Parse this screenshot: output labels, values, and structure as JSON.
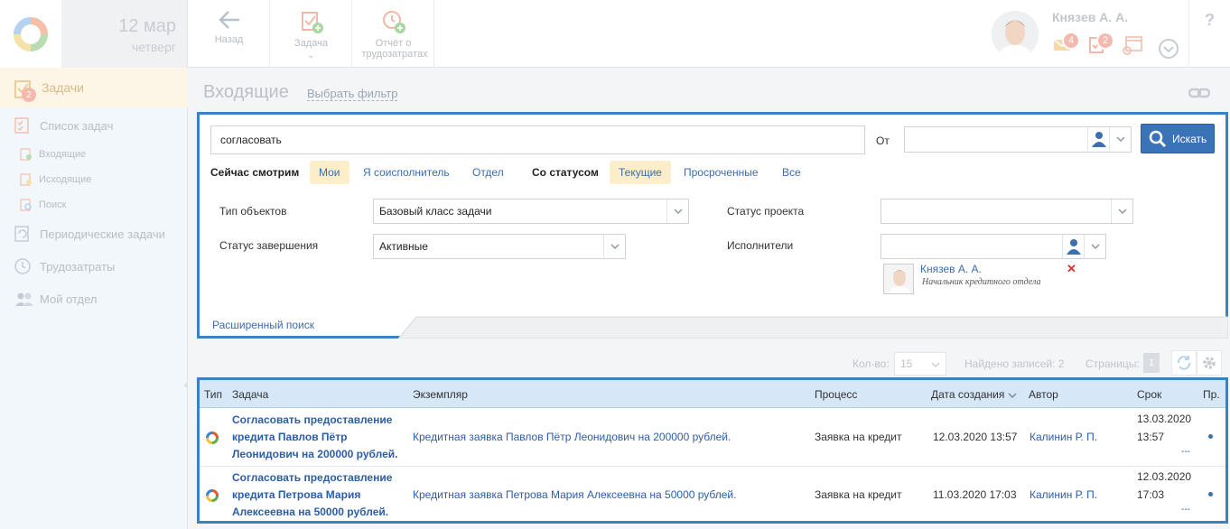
{
  "header": {
    "date_day": "12 мар",
    "date_weekday": "четверг",
    "toolbar": {
      "back": "Назад",
      "task": "Задача",
      "report": "Отчёт о трудозатратах"
    },
    "user": {
      "name": "Князев А. А.",
      "mail_count": "4",
      "tasks_count": "2"
    },
    "help": "?"
  },
  "sidebar": {
    "items": [
      {
        "label": "Задачи",
        "badge": "2"
      },
      {
        "label": "Список задач"
      },
      {
        "label": "Входящие"
      },
      {
        "label": "Исходящие"
      },
      {
        "label": "Поиск"
      },
      {
        "label": "Периодические задачи"
      },
      {
        "label": "Трудозатраты"
      },
      {
        "label": "Мой отдел"
      }
    ]
  },
  "page": {
    "title": "Входящие",
    "filter_link": "Выбрать фильтр"
  },
  "filter": {
    "query": "согласовать",
    "from_label": "От",
    "search_button": "Искать",
    "now_viewing_label": "Сейчас смотрим",
    "scope_chips": [
      "Мои",
      "Я соисполнитель",
      "Отдел"
    ],
    "status_label": "Со статусом",
    "status_chips": [
      "Текущие",
      "Просроченные",
      "Все"
    ],
    "object_type_label": "Тип объектов",
    "object_type_value": "Базовый класс задачи",
    "completion_status_label": "Статус завершения",
    "completion_status_value": "Активные",
    "project_status_label": "Статус проекта",
    "executors_label": "Исполнители",
    "executor": {
      "name": "Князев А. А.",
      "role": "Начальник кредитного отдела"
    },
    "advanced_search": "Расширенный поиск"
  },
  "pager": {
    "count_label": "Кол-во:",
    "count_value": "15",
    "found_label": "Найдено записей: 2",
    "pages_label": "Страницы:",
    "page_value": "1"
  },
  "table": {
    "columns": [
      "Тип",
      "Задача",
      "Экземпляр",
      "Процесс",
      "Дата создания",
      "Автор",
      "Срок",
      "Пр."
    ],
    "rows": [
      {
        "task_l1": "Согласовать предоставление",
        "task_l2": "кредита Павлов Пётр",
        "task_l3": "Леонидович на 200000 рублей.",
        "instance": "Кредитная заявка Павлов Пётр Леонидович на 200000 рублей.",
        "process": "Заявка на кредит",
        "created": "12.03.2020 13:57",
        "author": "Калинин Р. П.",
        "due_date": "13.03.2020",
        "due_time": "13:57",
        "due_extra": "---"
      },
      {
        "task_l1": "Согласовать предоставление",
        "task_l2": "кредита Петрова Мария",
        "task_l3": "Алексеевна на 50000 рублей.",
        "instance": "Кредитная заявка Петрова Мария Алексеевна на 50000 рублей.",
        "process": "Заявка на кредит",
        "created": "11.03.2020 17:03",
        "author": "Калинин Р. П.",
        "due_date": "12.03.2020",
        "due_time": "17:03",
        "due_extra": "---"
      }
    ]
  }
}
